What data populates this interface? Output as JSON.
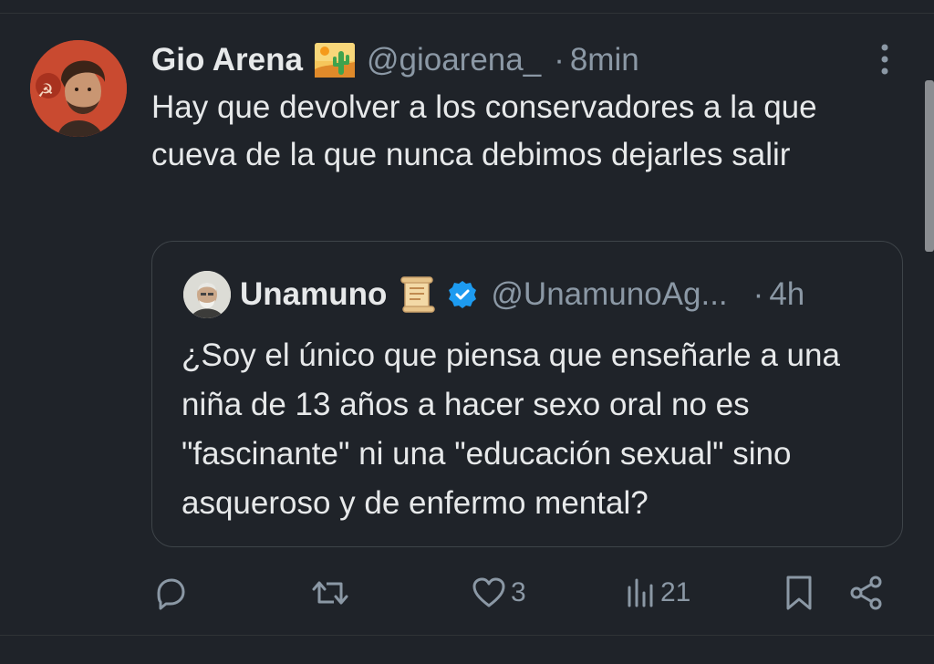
{
  "tweet": {
    "display_name": "Gio Arena",
    "name_emoji": "desert-cactus-emoji",
    "handle": "@gioarena_",
    "separator": "·",
    "time": "8min",
    "text": "Hay que devolver a los conservadores a la que cueva de la que nunca debimos dejarles salir"
  },
  "quoted_tweet": {
    "display_name": "Unamuno",
    "name_emoji": "scroll-emoji",
    "verified": true,
    "handle": "@UnamunoAg...",
    "separator": "·",
    "time": "4h",
    "text": "¿Soy el único que piensa que enseñarle a una niña de 13 años a hacer sexo oral no es \"fascinante\" ni una \"educación sexual\" sino asqueroso y de enfermo mental?"
  },
  "actions": {
    "reply_count": "",
    "retweet_count": "",
    "like_count": "3",
    "views_count": "21"
  },
  "colors": {
    "background": "#1f2329",
    "text_primary": "#e7e9ea",
    "text_secondary": "#8b98a5",
    "verified_blue": "#1d9bf0",
    "border": "#3e4449"
  }
}
